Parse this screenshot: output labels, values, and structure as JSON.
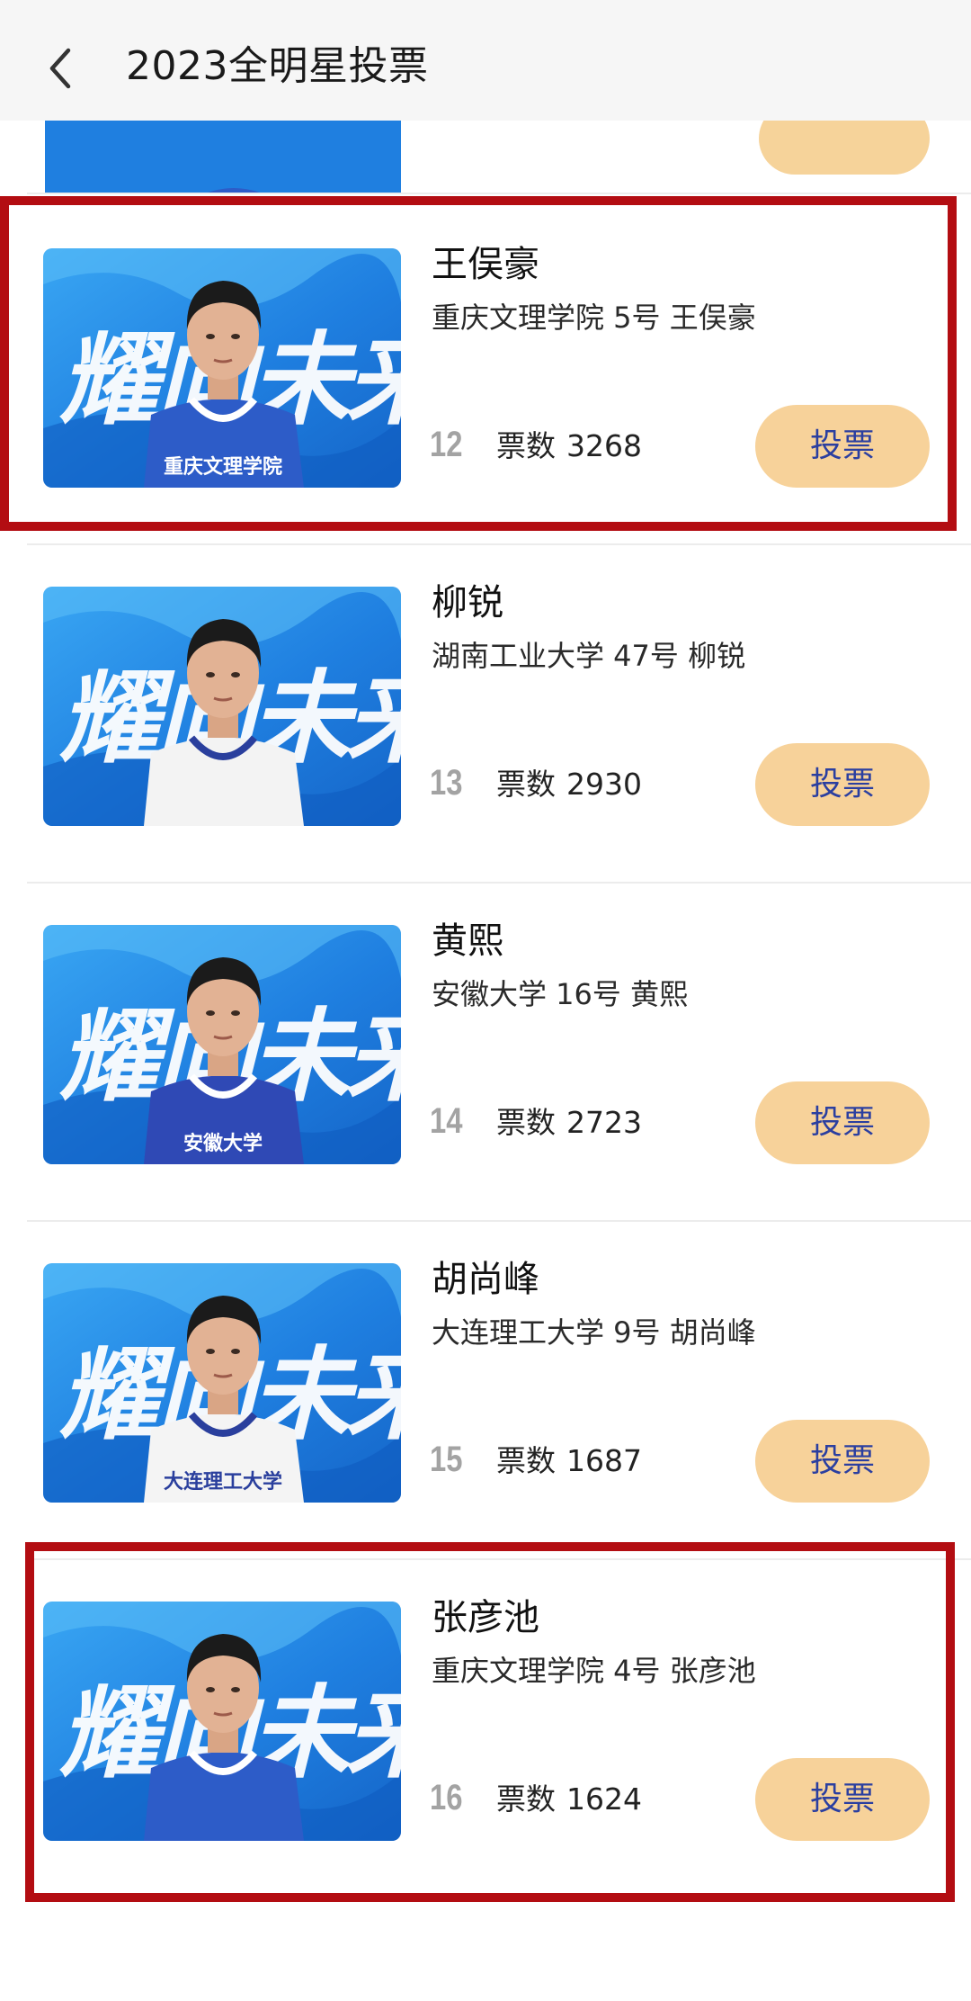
{
  "header": {
    "title": "2023全明星投票"
  },
  "poster_text": "耀向未来",
  "players": [
    {
      "name": "王俣豪",
      "desc": "重庆文理学院 5号 王俣豪",
      "rank": "12",
      "votes_label": "票数",
      "votes": "3268",
      "button": "投票",
      "jersey": "#2d5cc8",
      "jersey_text": "重庆文理学院",
      "highlighted": true
    },
    {
      "name": "柳锐",
      "desc": "湖南工业大学 47号 柳锐",
      "rank": "13",
      "votes_label": "票数",
      "votes": "2930",
      "button": "投票",
      "jersey": "#f3f3f3",
      "jersey_text": "",
      "highlighted": false
    },
    {
      "name": "黄熙",
      "desc": "安徽大学 16号 黄熙",
      "rank": "14",
      "votes_label": "票数",
      "votes": "2723",
      "button": "投票",
      "jersey": "#2f49b5",
      "jersey_text": "安徽大学",
      "highlighted": false
    },
    {
      "name": "胡尚峰",
      "desc": "大连理工大学 9号 胡尚峰",
      "rank": "15",
      "votes_label": "票数",
      "votes": "1687",
      "button": "投票",
      "jersey": "#f4f4f4",
      "jersey_text": "大连理工大学",
      "highlighted": false
    },
    {
      "name": "张彦池",
      "desc": "重庆文理学院 4号 张彦池",
      "rank": "16",
      "votes_label": "票数",
      "votes": "1624",
      "button": "投票",
      "jersey": "#2d5cc8",
      "jersey_text": "",
      "highlighted": true
    }
  ],
  "colors": {
    "vote_button": "#f7d29a",
    "vote_button_text": "#2b3fa0",
    "highlight": "#b30d12",
    "poster_blue": "#1f7fe0"
  }
}
